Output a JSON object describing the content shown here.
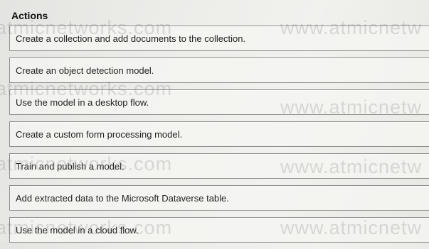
{
  "panel": {
    "title": "Actions"
  },
  "actions": [
    {
      "label": "Create a collection and add documents to the collection."
    },
    {
      "label": "Create an object detection model."
    },
    {
      "label": "Use the model in a desktop flow."
    },
    {
      "label": "Create a custom form processing model."
    },
    {
      "label": "Train and publish a model."
    },
    {
      "label": "Add extracted data to the Microsoft Dataverse table."
    },
    {
      "label": "Use the model in a cloud flow."
    }
  ],
  "watermark": {
    "left": "atmicnetworks.com",
    "right": "www.atmicnetw"
  }
}
